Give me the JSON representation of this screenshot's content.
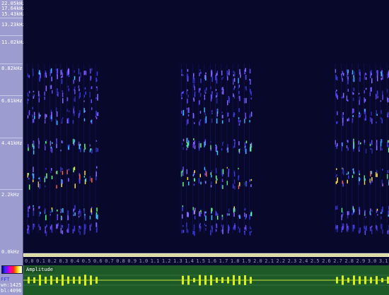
{
  "frequency_axis": {
    "labels": [
      "22.05kHz",
      "17.64kHz",
      "15.43kHz",
      "13.23kHz",
      "11.02kHz",
      "8.82kHz",
      "6.61kHz",
      "4.41kHz",
      "2.2kHz",
      "0.0kHz"
    ]
  },
  "time_axis": {
    "labels": [
      "0.0",
      "0.1",
      "0.2",
      "0.3",
      "0.4",
      "0.5",
      "0.6",
      "0.7",
      "0.8",
      "0.9",
      "1.0",
      "1.1",
      "1.2",
      "1.3",
      "1.4",
      "1.5",
      "1.6",
      "1.7",
      "1.8",
      "1.9",
      "2.0",
      "2.1",
      "2.2",
      "2.3",
      "2.4",
      "2.5",
      "2.6",
      "2.7",
      "2.8",
      "2.9",
      "3.0",
      "3.1"
    ]
  },
  "panel": {
    "fft_label": "FFT",
    "wn_label": "wn:1425",
    "bl_label": "bl:4096"
  },
  "amplitude": {
    "label": "Amplitude"
  },
  "colors": {
    "spectrogram_bg": "#08082a",
    "amplitude_bg": "#1e5a28",
    "waveform": "#d8f018",
    "axis_bg": "#9c9cd0"
  }
}
